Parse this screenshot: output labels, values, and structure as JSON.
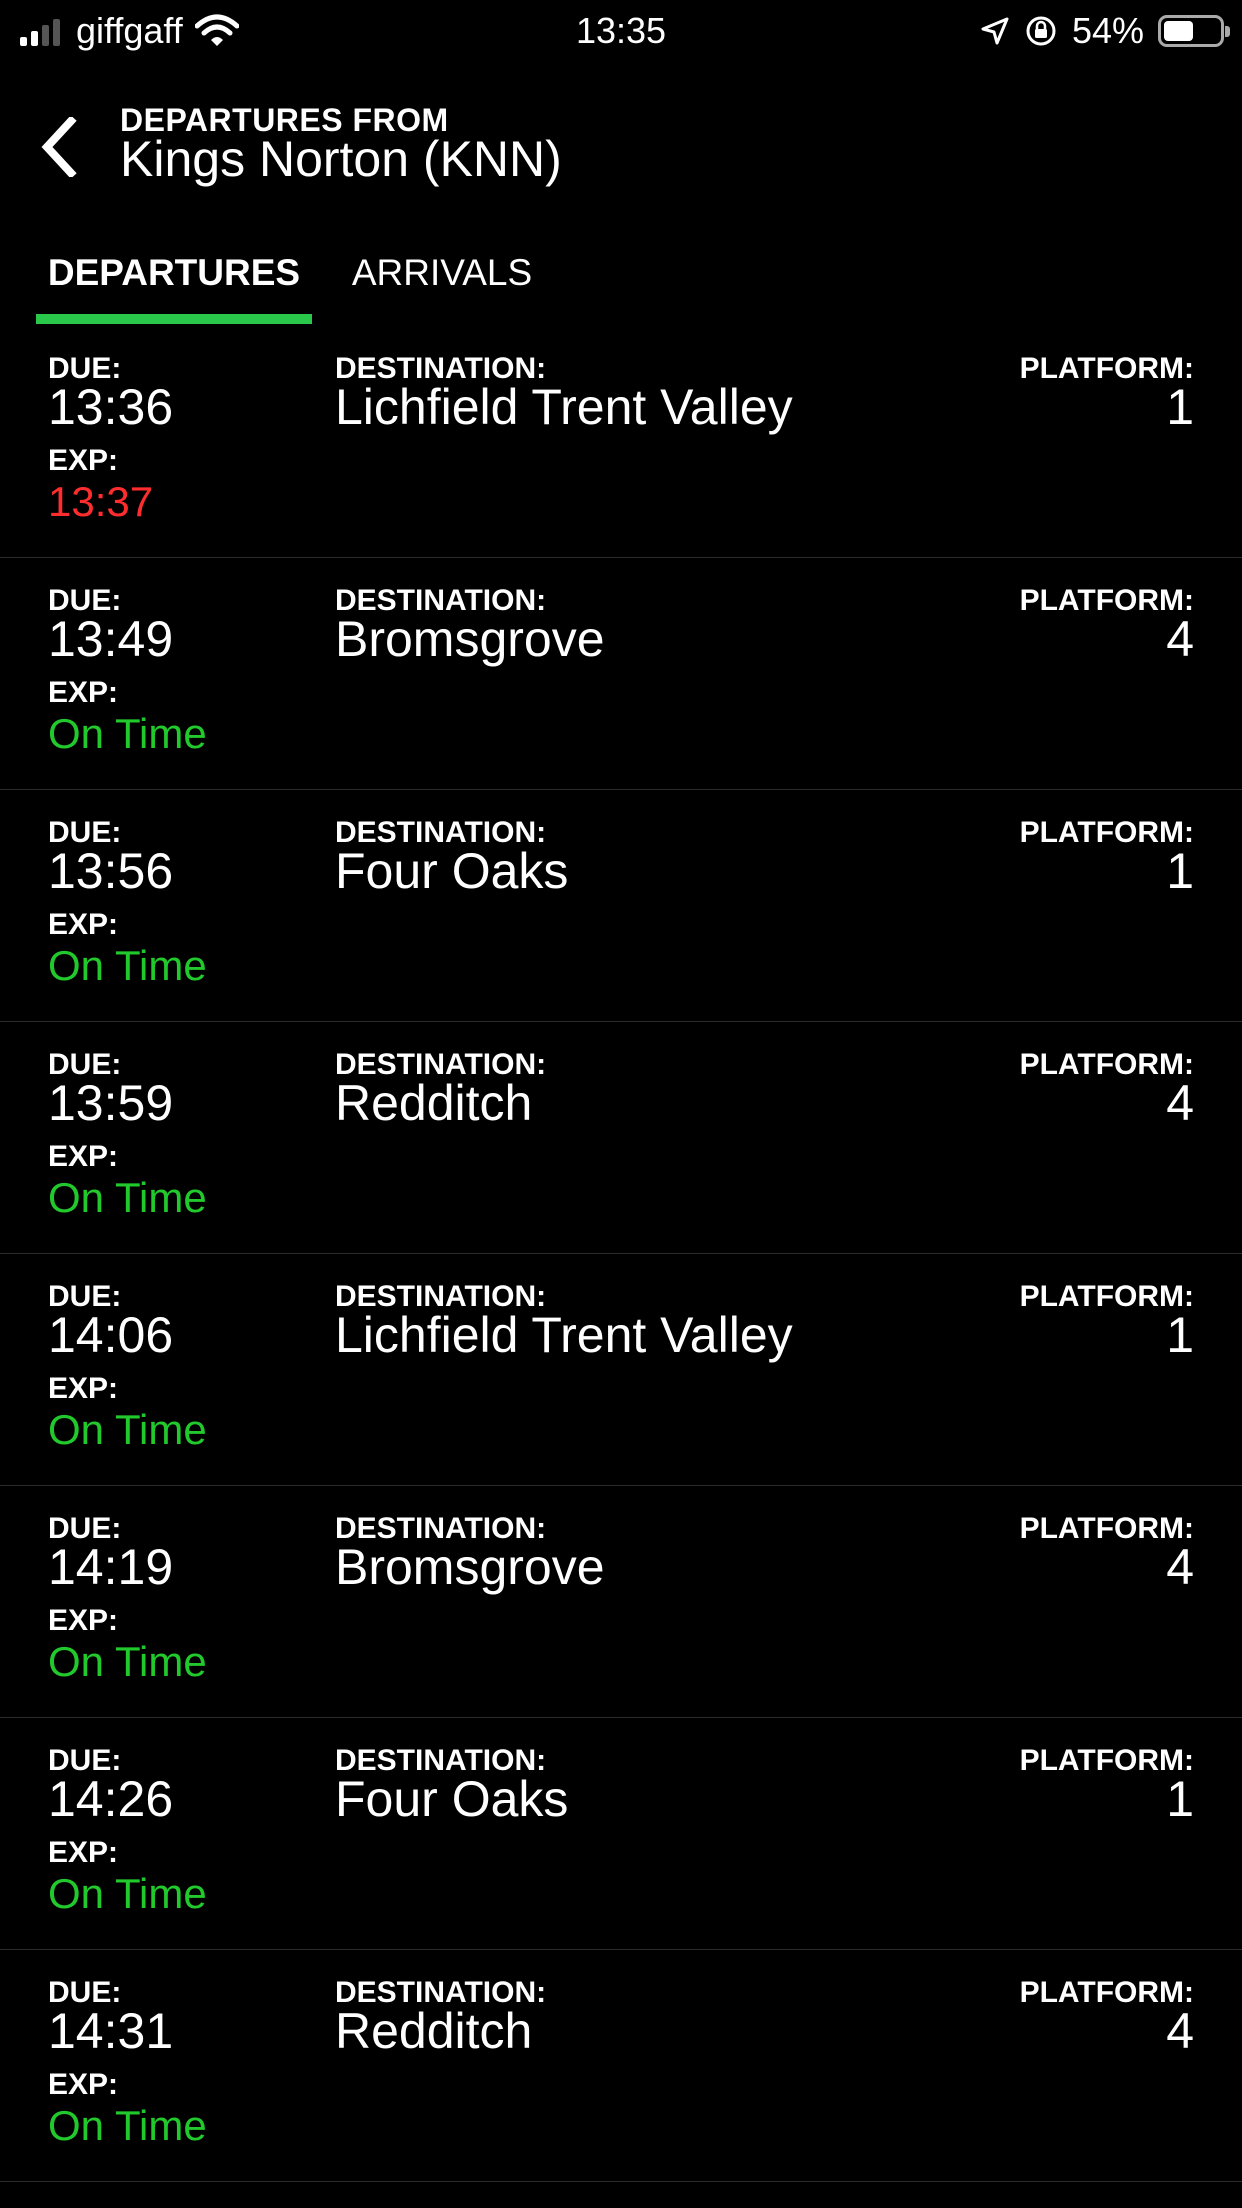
{
  "status_bar": {
    "carrier": "giffgaff",
    "time": "13:35",
    "battery": "54%",
    "battery_level": 0.54
  },
  "header": {
    "subtitle": "DEPARTURES FROM",
    "title": "Kings Norton (KNN)"
  },
  "tabs": [
    {
      "label": "DEPARTURES",
      "active": true
    },
    {
      "label": "ARRIVALS",
      "active": false
    }
  ],
  "labels": {
    "due": "DUE:",
    "exp": "EXP:",
    "destination": "DESTINATION:",
    "platform": "PLATFORM:"
  },
  "colors": {
    "accent": "#2ac84a",
    "on_time": "#22c92c",
    "late": "#ff2d2d"
  },
  "departures": [
    {
      "due": "13:36",
      "exp": "13:37",
      "status": "late",
      "destination": "Lichfield Trent Valley",
      "platform": "1"
    },
    {
      "due": "13:49",
      "exp": "On Time",
      "status": "ontime",
      "destination": "Bromsgrove",
      "platform": "4"
    },
    {
      "due": "13:56",
      "exp": "On Time",
      "status": "ontime",
      "destination": "Four Oaks",
      "platform": "1"
    },
    {
      "due": "13:59",
      "exp": "On Time",
      "status": "ontime",
      "destination": "Redditch",
      "platform": "4"
    },
    {
      "due": "14:06",
      "exp": "On Time",
      "status": "ontime",
      "destination": "Lichfield Trent Valley",
      "platform": "1"
    },
    {
      "due": "14:19",
      "exp": "On Time",
      "status": "ontime",
      "destination": "Bromsgrove",
      "platform": "4"
    },
    {
      "due": "14:26",
      "exp": "On Time",
      "status": "ontime",
      "destination": "Four Oaks",
      "platform": "1"
    },
    {
      "due": "14:31",
      "exp": "On Time",
      "status": "ontime",
      "destination": "Redditch",
      "platform": "4"
    }
  ]
}
